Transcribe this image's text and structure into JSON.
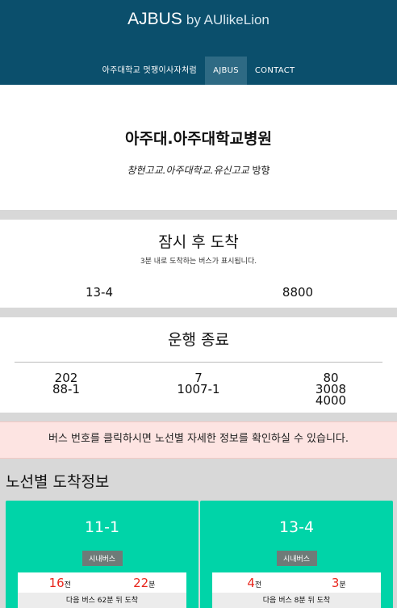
{
  "header": {
    "brand_main": "AJBUS",
    "brand_by": "by AUlikeLion",
    "nav": [
      "아주대학교 멋쟁이사자처럼",
      "AJBUS",
      "CONTACT"
    ]
  },
  "stop": {
    "title": "아주대.아주대학교병원",
    "direction_italic": "창현고교.아주대학교.유신고교",
    "direction_suffix": "방향"
  },
  "arriving": {
    "title": "잠시 후 도착",
    "subtitle": "3분 내로 도착하는 버스가 표시됩니다.",
    "buses": [
      "13-4",
      "8800"
    ]
  },
  "ended": {
    "title": "운행 종료",
    "columns": [
      [
        "202",
        "88-1"
      ],
      [
        "7",
        "1007-1"
      ],
      [
        "80",
        "3008",
        "4000"
      ]
    ]
  },
  "notice": "버스 번호를 클릭하시면 노선별 자세한 정보를 확인하실 수 있습니다.",
  "routes": {
    "title": "노선별 도착정보",
    "cards": [
      {
        "number": "11-1",
        "type": "시내버스",
        "first_time": "16",
        "first_unit": "전",
        "second_time": "22",
        "second_unit": "분",
        "next_prefix": "다음 버스",
        "next_value": "62",
        "next_suffix": "분 뒤 도착"
      },
      {
        "number": "13-4",
        "type": "시내버스",
        "first_time": "4",
        "first_unit": "전",
        "second_time": "3",
        "second_unit": "분",
        "next_prefix": "다음 버스",
        "next_value": "8",
        "next_suffix": "분 뒤 도착"
      }
    ]
  },
  "colors": {
    "header": "#0b4f6c",
    "nav_active": "#2e6a84",
    "card": "#00d4a8",
    "time": "#e8261c",
    "notice_bg": "#fde4e2"
  }
}
